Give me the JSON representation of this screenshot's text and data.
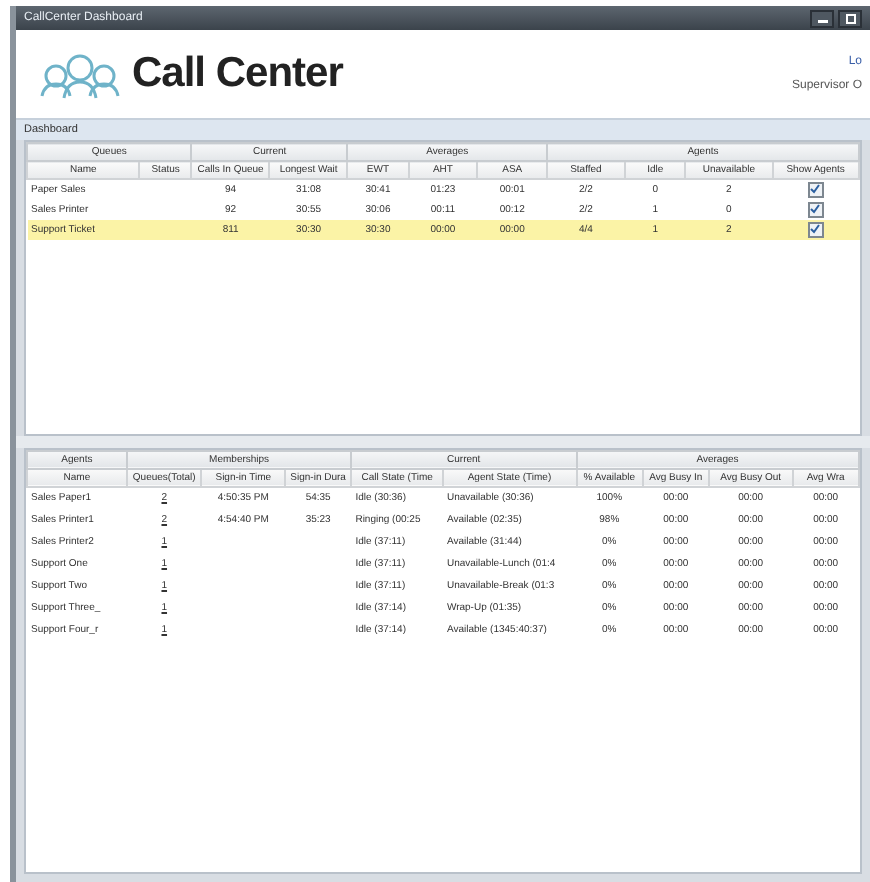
{
  "window": {
    "title": "CallCenter Dashboard"
  },
  "header": {
    "title": "Call Center",
    "link": "Lo",
    "user": "Supervisor O"
  },
  "section": {
    "title": "Dashboard"
  },
  "queues": {
    "groups": [
      "Queues",
      "Current",
      "Averages",
      "Agents"
    ],
    "columns": [
      "Name",
      "Status",
      "Calls In Queue",
      "Longest Wait",
      "EWT",
      "AHT",
      "ASA",
      "Staffed",
      "Idle",
      "Unavailable",
      "Show Agents"
    ],
    "rows": [
      {
        "cells": [
          "Paper Sales",
          "",
          "94",
          "31:08",
          "30:41",
          "01:23",
          "00:01",
          "2/2",
          "0",
          "2"
        ],
        "show_agents": true,
        "selected": false
      },
      {
        "cells": [
          "Sales Printer",
          "",
          "92",
          "30:55",
          "30:06",
          "00:11",
          "00:12",
          "2/2",
          "1",
          "0"
        ],
        "show_agents": true,
        "selected": false
      },
      {
        "cells": [
          "Support Ticket",
          "",
          "811",
          "30:30",
          "30:30",
          "00:00",
          "00:00",
          "4/4",
          "1",
          "2"
        ],
        "show_agents": true,
        "selected": true
      }
    ]
  },
  "agents": {
    "groups": [
      "Agents",
      "Memberships",
      "Current",
      "Averages"
    ],
    "columns": [
      "Name",
      "Queues(Total)",
      "Sign-in Time",
      "Sign-in Dura",
      "Call State (Time",
      "Agent State (Time)",
      "% Available",
      "Avg Busy In",
      "Avg Busy Out",
      "Avg Wra"
    ],
    "rows": [
      {
        "cells": [
          "Sales Paper1",
          "2",
          "4:50:35 PM",
          "54:35",
          "Idle (30:36)",
          "Unavailable (30:36)",
          "100%",
          "00:00",
          "00:00",
          "00:00"
        ]
      },
      {
        "cells": [
          "Sales Printer1",
          "2",
          "4:54:40 PM",
          "35:23",
          "Ringing (00:25",
          "Available (02:35)",
          "98%",
          "00:00",
          "00:00",
          "00:00"
        ]
      },
      {
        "cells": [
          "Sales Printer2",
          "1",
          "",
          "",
          "Idle (37:11)",
          "Available (31:44)",
          "0%",
          "00:00",
          "00:00",
          "00:00"
        ]
      },
      {
        "cells": [
          "Support One",
          "1",
          "",
          "",
          "Idle (37:11)",
          "Unavailable-Lunch (01:4",
          "0%",
          "00:00",
          "00:00",
          "00:00"
        ]
      },
      {
        "cells": [
          "Support Two",
          "1",
          "",
          "",
          "Idle (37:11)",
          "Unavailable-Break (01:3",
          "0%",
          "00:00",
          "00:00",
          "00:00"
        ]
      },
      {
        "cells": [
          "Support Three_",
          "1",
          "",
          "",
          "Idle (37:14)",
          "Wrap-Up (01:35)",
          "0%",
          "00:00",
          "00:00",
          "00:00"
        ]
      },
      {
        "cells": [
          "Support Four_r",
          "1",
          "",
          "",
          "Idle (37:14)",
          "Available (1345:40:37)",
          "0%",
          "00:00",
          "00:00",
          "00:00"
        ]
      }
    ]
  }
}
